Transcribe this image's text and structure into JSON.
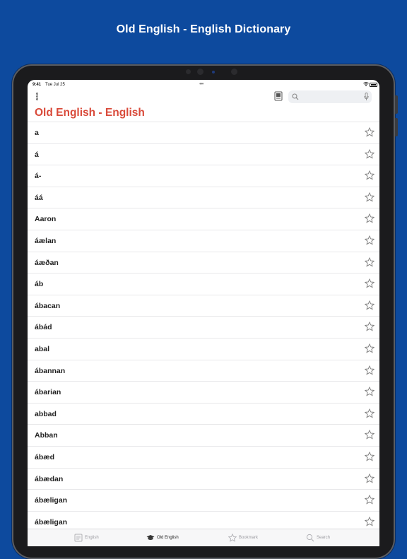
{
  "promo": {
    "title": "Old English - English Dictionary"
  },
  "status_bar": {
    "time": "9:41",
    "date": "Tue Jul 25"
  },
  "toolbar": {
    "search_placeholder": ""
  },
  "page": {
    "title": "Old English - English"
  },
  "list": {
    "items": [
      "a",
      "á",
      "á-",
      "áá",
      "Aaron",
      "áælan",
      "áæðan",
      "áb",
      "ábacan",
      "ábád",
      "abal",
      "ábannan",
      "ábarian",
      "abbad",
      "Abban",
      "ábæd",
      "ábædan",
      "ábæligan",
      "ábæligan"
    ]
  },
  "tab_bar": {
    "tabs": [
      {
        "label": "English",
        "icon": "dictionary-icon",
        "active": false
      },
      {
        "label": "Old English",
        "icon": "graduation-cap-icon",
        "active": true
      },
      {
        "label": "Bookmark",
        "icon": "star-icon",
        "active": false
      },
      {
        "label": "Search",
        "icon": "search-icon",
        "active": false
      }
    ]
  },
  "colors": {
    "background": "#0d4a9e",
    "accent": "#d94a3a",
    "device": "#1b1b1d"
  }
}
